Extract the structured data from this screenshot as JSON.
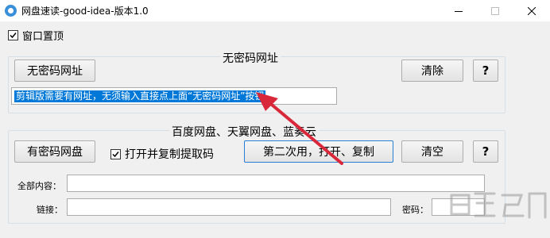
{
  "window": {
    "title": "网盘速读-good-idea-版本1.0",
    "controls": {
      "minimize": "minimize-icon",
      "maximize": "maximize-icon",
      "close": "close-icon"
    }
  },
  "topmost": {
    "label": "窗口置顶",
    "checked": true
  },
  "no_password_group": {
    "title": "无密码网址",
    "button_label": "无密码网址",
    "clear_label": "清除",
    "help_label": "?",
    "url_field_value": "剪辑版需要有网址，无须输入直接点上面“无密码网址”按钮"
  },
  "password_group": {
    "title": "百度网盘、天翼网盘、蓝奏云",
    "button_label": "有密码网盘",
    "checkbox_label": "打开并复制提取码",
    "checkbox_checked": true,
    "second_use_label": "第二次用，打开、复制",
    "clear_label": "清空",
    "help_label": "?",
    "all_content_label": "全部内容：",
    "all_content_value": "",
    "link_label": "链接：",
    "link_value": "",
    "password_label": "密码：",
    "password_value": ""
  },
  "colors": {
    "selection": "#0078d7",
    "arrow": "#d8283a",
    "focus_border": "#2a7fd4"
  }
}
